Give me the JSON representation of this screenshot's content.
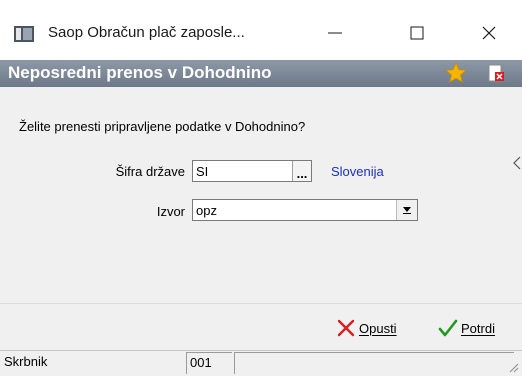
{
  "window": {
    "title": "Saop Obračun plač zaposle...",
    "controls": {
      "minimize": "—",
      "maximize": "☐",
      "close": "✕"
    }
  },
  "header": {
    "title": "Neposredni prenos v Dohodnino",
    "icons": [
      "star-icon",
      "document-delete-icon"
    ],
    "colors": {
      "strip": "#7b8696",
      "title": "#ffffff",
      "star": "#f5b400"
    }
  },
  "dialog": {
    "question": "Želite prenesti pripravljene podatke v Dohodnino?",
    "country_code": {
      "label": "Šifra države",
      "value": "SI",
      "button_label": "...",
      "name": "Slovenija"
    },
    "source": {
      "label": "Izvor",
      "value": "opz"
    }
  },
  "buttons": {
    "cancel": {
      "label": "Opusti",
      "icon": "red-x-icon"
    },
    "confirm": {
      "label": "Potrdi",
      "icon": "green-check-icon"
    }
  },
  "status_bar": {
    "user": "Skrbnik",
    "number": "001"
  }
}
